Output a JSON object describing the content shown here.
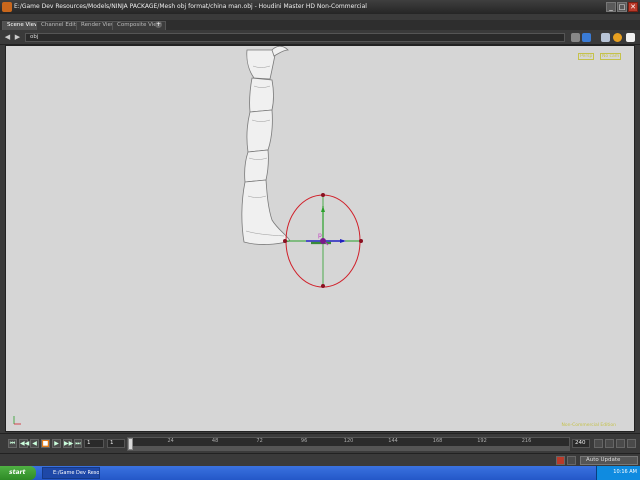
{
  "window": {
    "title": "E:/Game Dev Resources/Models/NINJA PACKAGE/Mesh obj format/china man.obj - Houdini Master HD Non-Commercial",
    "minimize_glyph": "_",
    "maximize_glyph": "□",
    "close_glyph": "✕"
  },
  "tabs": [
    {
      "label": "Scene View",
      "active": true
    },
    {
      "label": "Channel Editor",
      "active": false
    },
    {
      "label": "Render View",
      "active": false
    },
    {
      "label": "Composite View",
      "active": false
    }
  ],
  "tab_add_glyph": "+",
  "pathbar": {
    "back_glyph": "◀",
    "forward_glyph": "▶",
    "path": "obj"
  },
  "viewport": {
    "background_color": "#d6d6d6",
    "badges": [
      "Persp",
      "No cam"
    ],
    "note": "Non-Commercial Edition"
  },
  "playbar": {
    "buttons": [
      {
        "icon": "jump-start-icon",
        "glyph": "⏮"
      },
      {
        "icon": "step-back-icon",
        "glyph": "◀◀"
      },
      {
        "icon": "play-reverse-icon",
        "glyph": "◀"
      },
      {
        "icon": "stop-icon",
        "glyph": "■"
      },
      {
        "icon": "play-icon",
        "glyph": "▶"
      },
      {
        "icon": "step-forward-icon",
        "glyph": "▶▶"
      },
      {
        "icon": "jump-end-icon",
        "glyph": "⏭"
      }
    ],
    "start_frame": "1",
    "current_frame": "1",
    "ticks": [
      "24",
      "48",
      "72",
      "96",
      "120",
      "144",
      "168",
      "192",
      "216"
    ],
    "end_frame": "240",
    "total_frames": 240
  },
  "status": {
    "auto_update": "Auto Update"
  },
  "taskbar": {
    "start_label": "start",
    "task_label": "E:/Game Dev Resour...",
    "clock": "10:16 AM"
  },
  "colors": {
    "accent_orange": "#e07a18",
    "handle_red": "#d0202a",
    "axis_green": "#2aa02a",
    "axis_blue": "#2020c0"
  }
}
